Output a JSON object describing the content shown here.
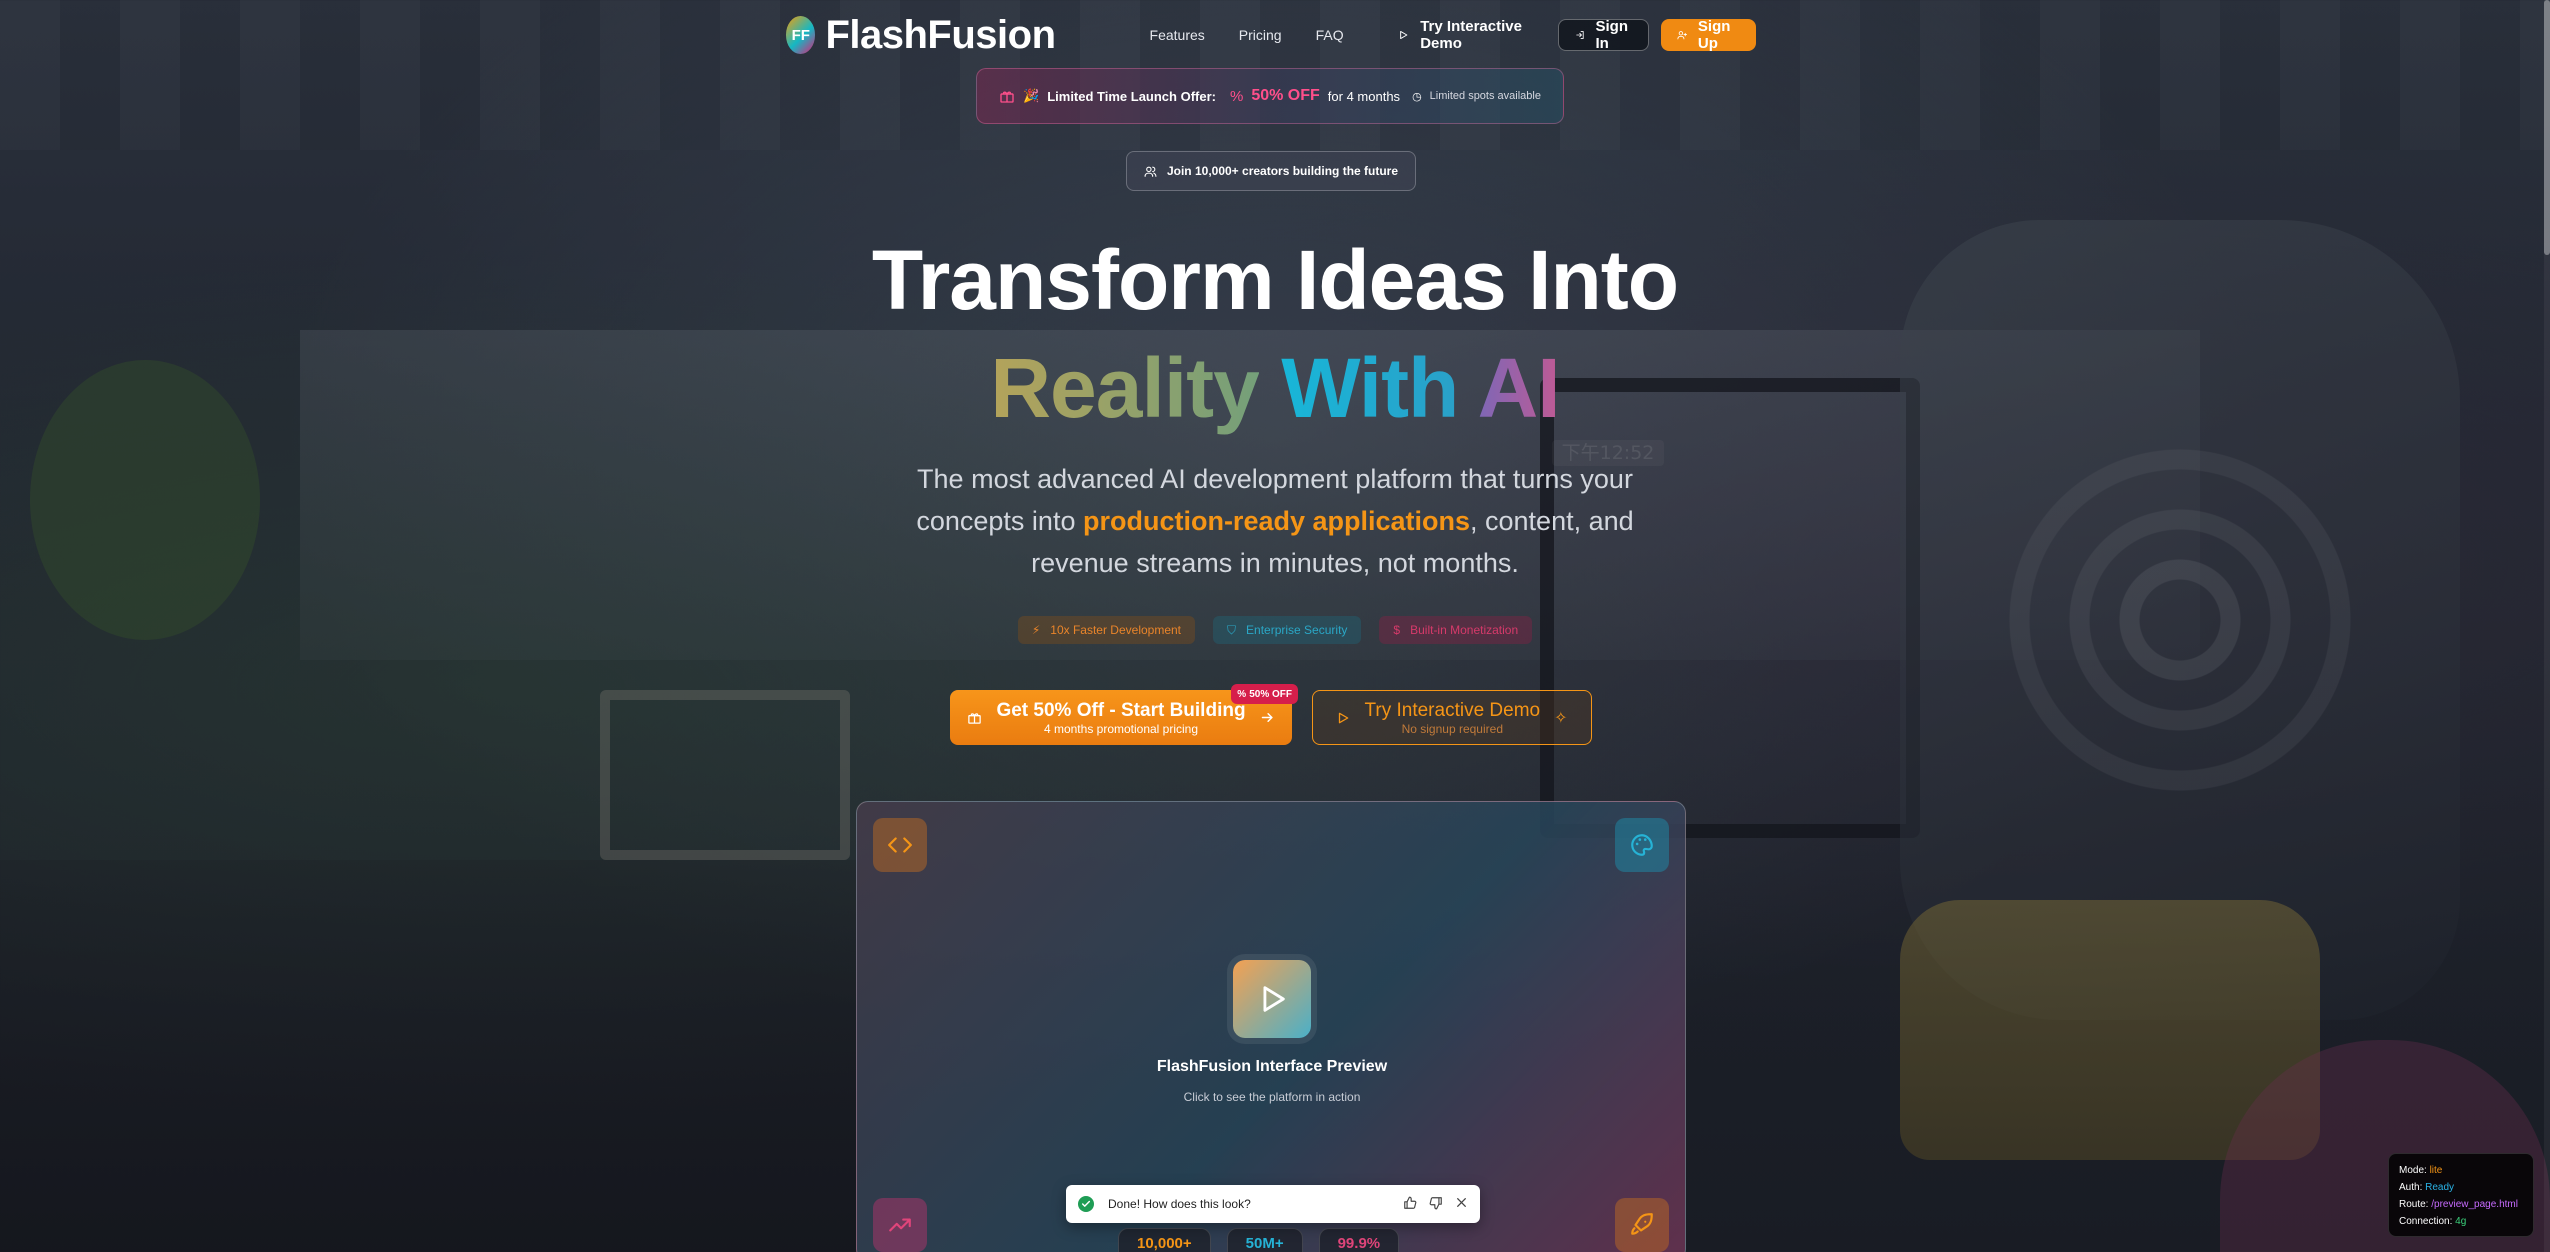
{
  "nav": {
    "logo_badge": "FF",
    "brand": "FlashFusion",
    "links": [
      "Features",
      "Pricing",
      "FAQ"
    ],
    "demo": "Try Interactive Demo",
    "signin": "Sign In",
    "signup": "Sign Up"
  },
  "offer": {
    "label": "Limited Time Launch Offer:",
    "discount": "50% OFF",
    "duration": "for 4 months",
    "spots": "Limited spots available"
  },
  "join": "Join 10,000+ creators building the future",
  "hero": {
    "line1": "Transform Ideas Into",
    "w1": "Reality",
    "w2": "With",
    "w3": "AI",
    "sub_before": "The most advanced AI development platform that turns your concepts into ",
    "sub_highlight": "production-ready applications",
    "sub_after": ", content, and revenue streams in minutes, not months."
  },
  "pills": [
    "10x Faster Development",
    "Enterprise Security",
    "Built-in Monetization"
  ],
  "cta": {
    "main": "Get 50% Off - Start Building",
    "main_sub": "4 months promotional pricing",
    "badge": "50% OFF",
    "demo": "Try Interactive Demo",
    "demo_sub": "No signup required"
  },
  "background_clock": "下午12:52",
  "preview": {
    "title": "FlashFusion Interface Preview",
    "subtitle": "Click to see the platform in action"
  },
  "stats": [
    "10,000+",
    "50M+",
    "99.9%"
  ],
  "toast": {
    "message": "Done! How does this look?"
  },
  "debug": {
    "mode_label": "Mode:",
    "mode": "lite",
    "auth_label": "Auth:",
    "auth": "Ready",
    "route_label": "Route:",
    "route": "/preview_page.html",
    "conn_label": "Connection:",
    "conn": "4g"
  },
  "colors": {
    "accent": "#f08a12",
    "cyan": "#14b8c4",
    "pink": "#e11d74"
  }
}
